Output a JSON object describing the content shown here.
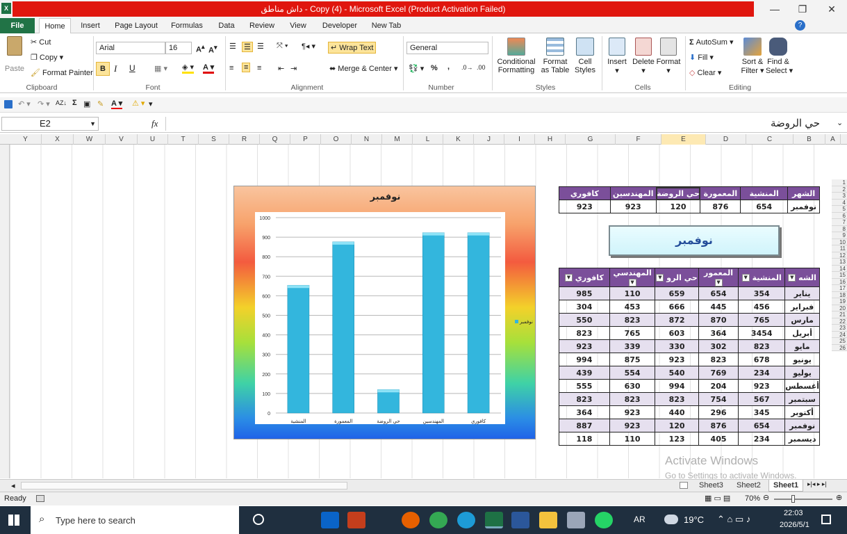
{
  "window": {
    "title": "داش مناطق - Copy (4)  -  Microsoft Excel (Product Activation Failed)"
  },
  "tabs": [
    "File",
    "Home",
    "Insert",
    "Page Layout",
    "Formulas",
    "Data",
    "Review",
    "View",
    "Developer",
    "New Tab"
  ],
  "ribbon": {
    "clipboard": {
      "paste": "Paste",
      "cut": "Cut",
      "copy": "Copy",
      "format_painter": "Format Painter",
      "label": "Clipboard"
    },
    "font": {
      "name": "Arial",
      "size": "16",
      "bold": "B",
      "italic": "I",
      "underline": "U",
      "label": "Font"
    },
    "alignment": {
      "wrap": "Wrap Text",
      "merge": "Merge & Center",
      "label": "Alignment"
    },
    "number": {
      "format": "General",
      "percent": "%",
      "comma": ",",
      "label": "Number"
    },
    "styles": {
      "cond": "Conditional",
      "cond2": "Formatting",
      "fmt": "Format",
      "fmt2": "as Table",
      "cell": "Cell",
      "cell2": "Styles",
      "label": "Styles"
    },
    "cells": {
      "insert": "Insert",
      "delete": "Delete",
      "format": "Format",
      "label": "Cells"
    },
    "editing": {
      "autosum": "AutoSum",
      "fill": "Fill",
      "clear": "Clear",
      "sort": "Sort &",
      "sort2": "Filter",
      "find": "Find &",
      "find2": "Select",
      "label": "Editing"
    }
  },
  "formula_bar": {
    "name_box": "E2",
    "fx": "fx",
    "content": "حي الروضة"
  },
  "columns": [
    "Y",
    "X",
    "W",
    "V",
    "U",
    "T",
    "S",
    "R",
    "Q",
    "P",
    "O",
    "N",
    "M",
    "L",
    "K",
    "J",
    "I",
    "H",
    "G",
    "F",
    "E",
    "D",
    "C",
    "B",
    "A"
  ],
  "rows": [
    "1",
    "2",
    "3",
    "4",
    "5",
    "6",
    "7",
    "8",
    "9",
    "10",
    "11",
    "12",
    "13",
    "14",
    "15",
    "16",
    "17",
    "18",
    "19",
    "20",
    "21",
    "22",
    "23",
    "24",
    "25",
    "26"
  ],
  "top_table": {
    "headers": [
      "الشهر",
      "المنشية",
      "المعمورة",
      "حي الروضة",
      "المهندسين",
      "كافوري"
    ],
    "row": [
      "نوفمبر",
      "654",
      "876",
      "120",
      "923",
      "923"
    ]
  },
  "month_button": "نوفمبر",
  "main_table": {
    "headers": [
      "الشه",
      "المنشية",
      "المعمور",
      "حي الرو",
      "المهندسي",
      "كافوري"
    ],
    "rows": [
      [
        "يناير",
        "354",
        "654",
        "659",
        "110",
        "985"
      ],
      [
        "فبراير",
        "456",
        "445",
        "666",
        "453",
        "304"
      ],
      [
        "مارس",
        "765",
        "870",
        "872",
        "823",
        "550"
      ],
      [
        "أبريل",
        "3454",
        "364",
        "603",
        "765",
        "823"
      ],
      [
        "مايو",
        "823",
        "302",
        "330",
        "339",
        "923"
      ],
      [
        "يونيو",
        "678",
        "823",
        "923",
        "875",
        "994"
      ],
      [
        "يوليو",
        "234",
        "769",
        "540",
        "554",
        "439"
      ],
      [
        "أغسطس",
        "923",
        "204",
        "994",
        "630",
        "555"
      ],
      [
        "سبتمبر",
        "567",
        "754",
        "823",
        "823",
        "823"
      ],
      [
        "أكتوبر",
        "345",
        "296",
        "440",
        "923",
        "364"
      ],
      [
        "نوفمبر",
        "654",
        "876",
        "120",
        "923",
        "887"
      ],
      [
        "ديسمبر",
        "234",
        "405",
        "123",
        "110",
        "118"
      ]
    ]
  },
  "chart_data": {
    "type": "bar",
    "title": "نوفمبر",
    "categories": [
      "المنشية",
      "المعمورة",
      "حي الروضة",
      "المهندسين",
      "كافوري"
    ],
    "values": [
      654,
      876,
      120,
      923,
      923
    ],
    "ylim": [
      0,
      1000
    ],
    "yticks": [
      "1000",
      "900",
      "800",
      "700",
      "600",
      "500",
      "400",
      "300",
      "200",
      "100",
      "0"
    ],
    "series": [
      {
        "name": "نوفمبر",
        "values": [
          654,
          876,
          120,
          923,
          923
        ]
      }
    ],
    "legend": "right",
    "grid": true,
    "bar_color": "#33b6dd"
  },
  "sheets": [
    "Sheet3",
    "Sheet2",
    "Sheet1"
  ],
  "status": {
    "ready": "Ready",
    "zoom": "70%"
  },
  "watermark": {
    "line1": "Activate Windows",
    "line2": "Go to Settings to activate Windows."
  },
  "taskbar": {
    "search": "Type here to search",
    "lang": "AR",
    "temp": "19°C",
    "time": "22:03",
    "date": "2026/5/1"
  }
}
